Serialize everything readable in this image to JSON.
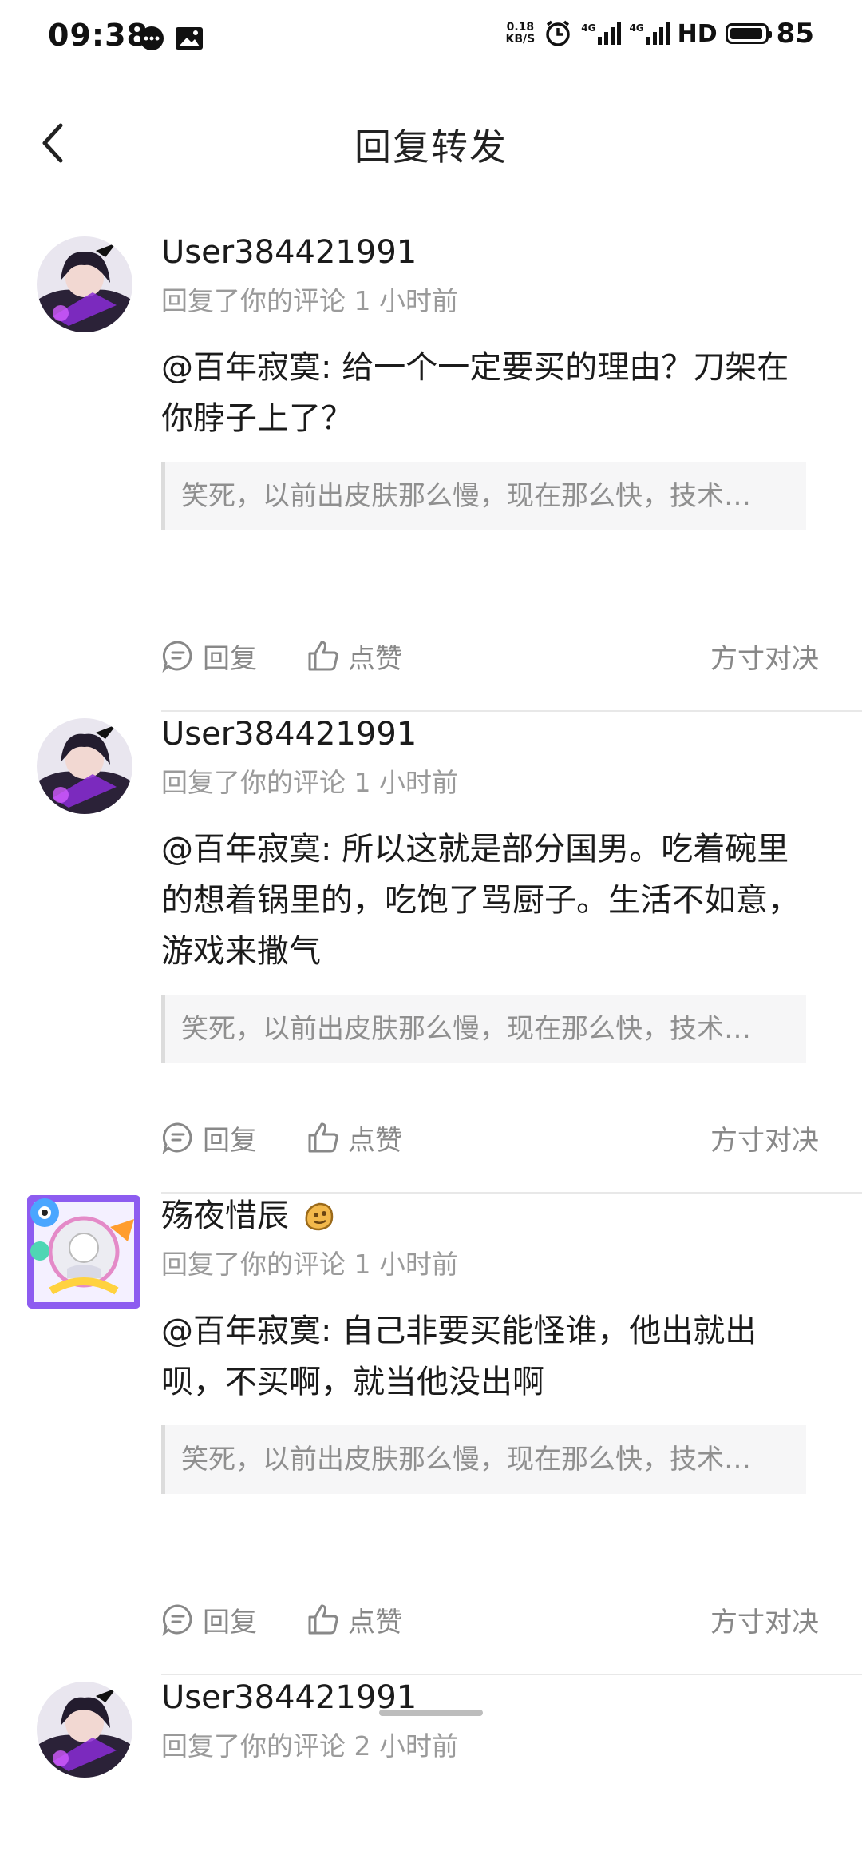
{
  "status_bar": {
    "time": "09:38",
    "net_speed_value": "0.18",
    "net_speed_unit": "KB/S",
    "signal1_label": "4G",
    "signal2_label": "4G",
    "hd_label": "HD",
    "battery_level": "85"
  },
  "header": {
    "title": "回复转发"
  },
  "items": [
    {
      "username": "User384421991",
      "meta": "回复了你的评论 1 小时前",
      "reply": "@百年寂寞: 给一个一定要买的理由？刀架在你脖子上了？",
      "quote": "笑死，以前出皮肤那么慢，现在那么快，技术…",
      "reply_label": "回复",
      "like_label": "点赞",
      "source": "方寸对决",
      "avatar_icon": "anime-girl-avatar-icon"
    },
    {
      "username": "User384421991",
      "meta": "回复了你的评论 1 小时前",
      "reply": "@百年寂寞: 所以这就是部分国男。吃着碗里的想着锅里的，吃饱了骂厨子。生活不如意，游戏来撒气",
      "quote": "笑死，以前出皮肤那么慢，现在那么快，技术…",
      "reply_label": "回复",
      "like_label": "点赞",
      "source": "方寸对决",
      "avatar_icon": "anime-girl-avatar-icon"
    },
    {
      "username": "殇夜惜辰",
      "meta": "回复了你的评论 1 小时前",
      "reply": "@百年寂寞: 自己非要买能怪谁，他出就出呗，不买啊，就当他没出啊",
      "quote": "笑死，以前出皮肤那么慢，现在那么快，技术…",
      "reply_label": "回复",
      "like_label": "点赞",
      "source": "方寸对决",
      "avatar_icon": "colorful-frame-avatar-icon",
      "badge_icon": "cookie-badge-icon"
    },
    {
      "username": "User384421991",
      "meta": "回复了你的评论 2 小时前",
      "avatar_icon": "anime-girl-avatar-icon"
    }
  ],
  "colors": {
    "text_primary": "#1b1b1b",
    "text_secondary": "#9a9a9a",
    "quote_bg": "#f6f6f7",
    "divider": "#e8e8e8"
  }
}
